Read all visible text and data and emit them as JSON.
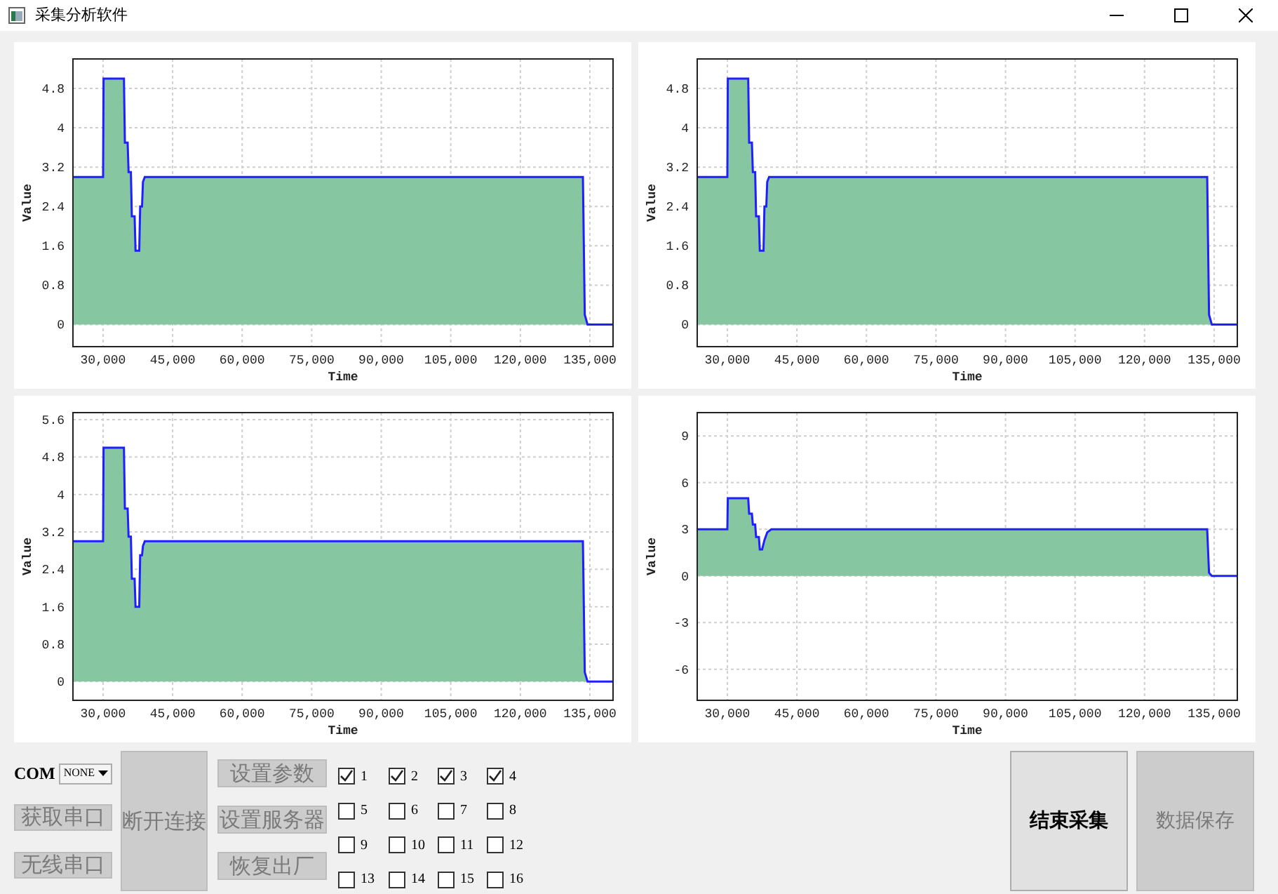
{
  "window": {
    "title": "采集分析软件"
  },
  "charts": [
    {
      "chart_data": {
        "type": "area",
        "xlabel": "Time",
        "ylabel": "Value",
        "x": [
          23500,
          30000,
          30100,
          34500,
          34700,
          35300,
          35500,
          36000,
          36200,
          36800,
          37000,
          37800,
          38000,
          38400,
          38600,
          39000,
          133500,
          133900,
          134500,
          135500,
          140000
        ],
        "series": [
          {
            "color": "#86c7a2",
            "values": [
              3,
              3,
              5,
              5,
              3.7,
              3.7,
              3.1,
              3.1,
              2.2,
              2.2,
              1.5,
              1.5,
              2.4,
              2.4,
              2.9,
              3,
              3,
              0.2,
              0,
              0,
              0
            ]
          }
        ],
        "grid": true,
        "xlim": [
          23500,
          140000
        ],
        "ylim": [
          -0.45,
          5.4
        ],
        "xticks": [
          {
            "value": 30000,
            "label": "30,000"
          },
          {
            "value": 45000,
            "label": "45,000"
          },
          {
            "value": 60000,
            "label": "60,000"
          },
          {
            "value": 75000,
            "label": "75,000"
          },
          {
            "value": 90000,
            "label": "90,000"
          },
          {
            "value": 105000,
            "label": "105,000"
          },
          {
            "value": 120000,
            "label": "120,000"
          },
          {
            "value": 135000,
            "label": "135,000"
          }
        ],
        "yticks": [
          0,
          0.8,
          1.6,
          2.4,
          3.2,
          4,
          4.8
        ]
      }
    },
    {
      "chart_data": {
        "type": "area",
        "xlabel": "Time",
        "ylabel": "Value",
        "x": [
          23500,
          30000,
          30100,
          34500,
          34700,
          35300,
          35500,
          36000,
          36200,
          36800,
          37000,
          37800,
          38000,
          38400,
          38600,
          39000,
          133500,
          133900,
          134500,
          135500,
          140000
        ],
        "series": [
          {
            "color": "#86c7a2",
            "values": [
              3,
              3,
              5,
              5,
              3.7,
              3.7,
              3.1,
              3.1,
              2.2,
              2.2,
              1.5,
              1.5,
              2.4,
              2.4,
              2.9,
              3,
              3,
              0.2,
              0,
              0,
              0
            ]
          }
        ],
        "grid": true,
        "xlim": [
          23500,
          140000
        ],
        "ylim": [
          -0.45,
          5.4
        ],
        "xticks": [
          {
            "value": 30000,
            "label": "30,000"
          },
          {
            "value": 45000,
            "label": "45,000"
          },
          {
            "value": 60000,
            "label": "60,000"
          },
          {
            "value": 75000,
            "label": "75,000"
          },
          {
            "value": 90000,
            "label": "90,000"
          },
          {
            "value": 105000,
            "label": "105,000"
          },
          {
            "value": 120000,
            "label": "120,000"
          },
          {
            "value": 135000,
            "label": "135,000"
          }
        ],
        "yticks": [
          0,
          0.8,
          1.6,
          2.4,
          3.2,
          4,
          4.8
        ]
      }
    },
    {
      "chart_data": {
        "type": "area",
        "xlabel": "Time",
        "ylabel": "Value",
        "x": [
          23500,
          30000,
          30100,
          34500,
          34700,
          35300,
          35500,
          36000,
          36200,
          36800,
          37000,
          37800,
          38000,
          38400,
          38600,
          39000,
          133500,
          133900,
          134500,
          135500,
          140000
        ],
        "series": [
          {
            "color": "#86c7a2",
            "values": [
              3,
              3,
              5,
              5,
              3.7,
              3.7,
              3.1,
              3.1,
              2.2,
              2.2,
              1.6,
              1.6,
              2.7,
              2.7,
              2.9,
              3,
              3,
              0.2,
              0,
              0,
              0
            ]
          }
        ],
        "grid": true,
        "xlim": [
          23500,
          140000
        ],
        "ylim": [
          -0.4,
          5.75
        ],
        "xticks": [
          {
            "value": 30000,
            "label": "30,000"
          },
          {
            "value": 45000,
            "label": "45,000"
          },
          {
            "value": 60000,
            "label": "60,000"
          },
          {
            "value": 75000,
            "label": "75,000"
          },
          {
            "value": 90000,
            "label": "90,000"
          },
          {
            "value": 105000,
            "label": "105,000"
          },
          {
            "value": 120000,
            "label": "120,000"
          },
          {
            "value": 135000,
            "label": "135,000"
          }
        ],
        "yticks": [
          0,
          0.8,
          1.6,
          2.4,
          3.2,
          4,
          4.8,
          5.6
        ]
      }
    },
    {
      "chart_data": {
        "type": "area",
        "xlabel": "Time",
        "ylabel": "Value",
        "x": [
          23500,
          30000,
          30100,
          34500,
          34700,
          35300,
          35500,
          36000,
          36200,
          36800,
          37000,
          37500,
          38000,
          38600,
          39500,
          133500,
          133900,
          134500,
          135500,
          140000
        ],
        "series": [
          {
            "color": "#86c7a2",
            "values": [
              3,
              3,
              5,
              5,
              4,
              4,
              3.3,
              3.3,
              2.5,
              2.5,
              1.7,
              1.7,
              2.3,
              2.8,
              3,
              3,
              0.2,
              0,
              0,
              0
            ]
          }
        ],
        "grid": true,
        "xlim": [
          23500,
          140000
        ],
        "ylim": [
          -8,
          10.5
        ],
        "xticks": [
          {
            "value": 30000,
            "label": "30,000"
          },
          {
            "value": 45000,
            "label": "45,000"
          },
          {
            "value": 60000,
            "label": "60,000"
          },
          {
            "value": 75000,
            "label": "75,000"
          },
          {
            "value": 90000,
            "label": "90,000"
          },
          {
            "value": 105000,
            "label": "105,000"
          },
          {
            "value": 120000,
            "label": "120,000"
          },
          {
            "value": 135000,
            "label": "135,000"
          }
        ],
        "yticks": [
          -6,
          -3,
          0,
          3,
          6,
          9
        ]
      }
    }
  ],
  "controls": {
    "com_label": "COM",
    "com_port": {
      "value": "NONE"
    },
    "get_port_button": {
      "label": "获取串口",
      "disabled": true
    },
    "wireless_port_button": {
      "label": "无线串口",
      "disabled": true
    },
    "disconnect_button": {
      "label": "断开连接",
      "disabled": true
    },
    "settings_buttons": [
      {
        "label": "设置参数",
        "disabled": true
      },
      {
        "label": "设置服务器",
        "disabled": true
      },
      {
        "label": "恢复出厂",
        "disabled": true
      }
    ],
    "channels": [
      {
        "label": "1",
        "checked": true
      },
      {
        "label": "2",
        "checked": true
      },
      {
        "label": "3",
        "checked": true
      },
      {
        "label": "4",
        "checked": true
      },
      {
        "label": "5",
        "checked": false
      },
      {
        "label": "6",
        "checked": false
      },
      {
        "label": "7",
        "checked": false
      },
      {
        "label": "8",
        "checked": false
      },
      {
        "label": "9",
        "checked": false
      },
      {
        "label": "10",
        "checked": false
      },
      {
        "label": "11",
        "checked": false
      },
      {
        "label": "12",
        "checked": false
      },
      {
        "label": "13",
        "checked": false
      },
      {
        "label": "14",
        "checked": false
      },
      {
        "label": "15",
        "checked": false
      },
      {
        "label": "16",
        "checked": false
      }
    ],
    "stop_button": {
      "label": "结束采集",
      "disabled": false
    },
    "save_button": {
      "label": "数据保存",
      "disabled": true
    }
  }
}
